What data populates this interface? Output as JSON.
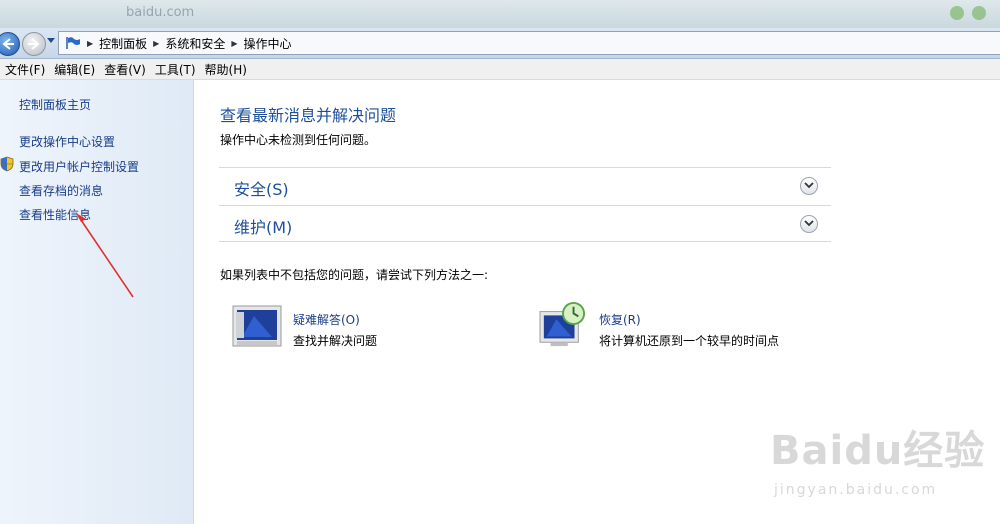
{
  "window": {
    "ghost_url": "baidu.com"
  },
  "address": {
    "crumbs": [
      "控制面板",
      "系统和安全",
      "操作中心"
    ]
  },
  "menu": [
    "文件(F)",
    "编辑(E)",
    "查看(V)",
    "工具(T)",
    "帮助(H)"
  ],
  "sidebar": {
    "items": [
      "控制面板主页",
      "更改操作中心设置",
      "更改用户帐户控制设置",
      "查看存档的消息",
      "查看性能信息"
    ]
  },
  "main": {
    "title": "查看最新消息并解决问题",
    "subtitle": "操作中心未检测到任何问题。",
    "sections": [
      "安全(S)",
      "维护(M)"
    ],
    "hint": "如果列表中不包括您的问题，请尝试下列方法之一:",
    "tiles": [
      {
        "title": "疑难解答(O)",
        "desc": "查找并解决问题",
        "icon": "troubleshoot-monitor-icon"
      },
      {
        "title": "恢复(R)",
        "desc": "将计算机还原到一个较早的时间点",
        "icon": "recovery-monitor-clock-icon"
      }
    ]
  },
  "watermark": {
    "logo": "Baidu经验",
    "site": "jingyan.baidu.com"
  },
  "colors": {
    "link": "#1a3d8a",
    "heading": "#1e4f9b",
    "annotation_arrow": "#e03030"
  }
}
